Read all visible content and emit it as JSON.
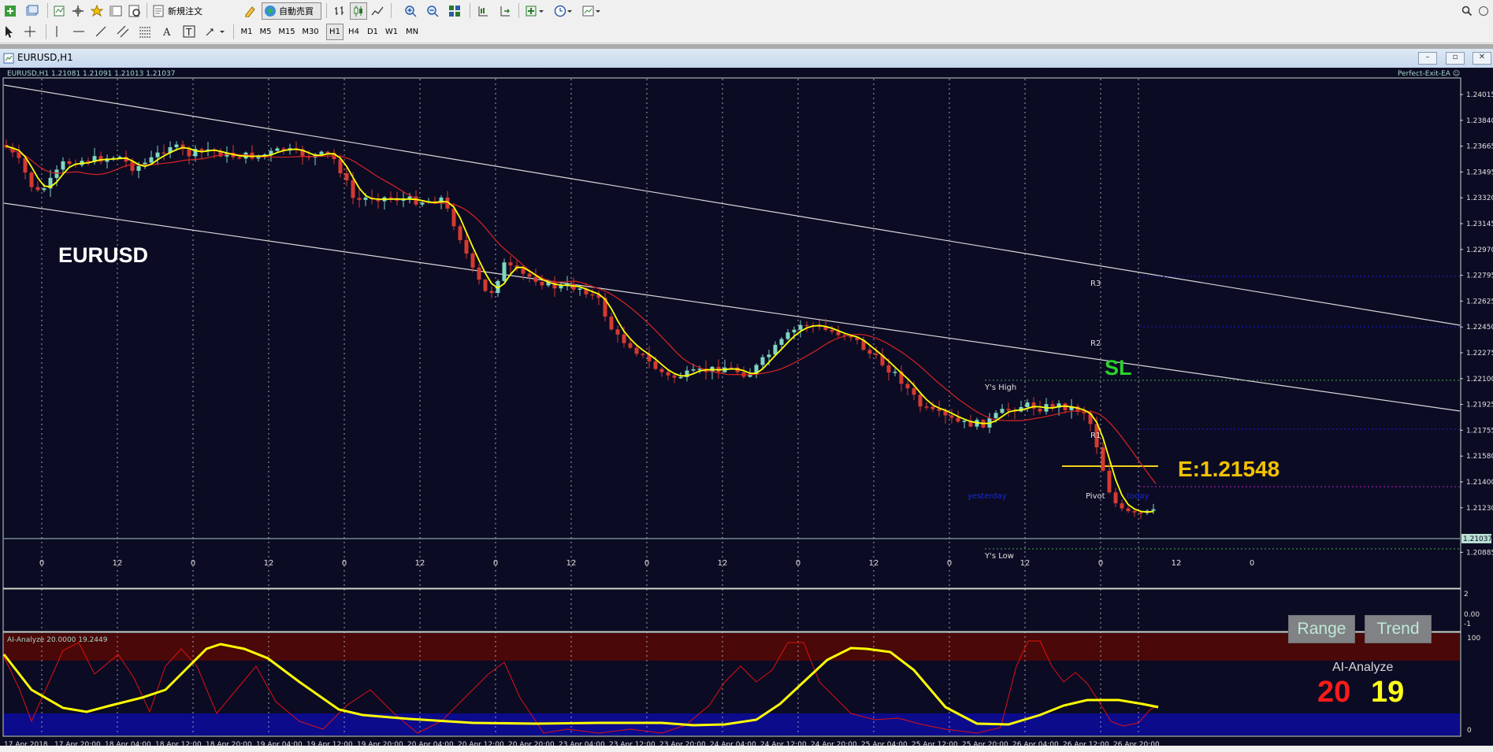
{
  "window": {
    "title": "EURUSD,H1"
  },
  "toolbar": {
    "new_order_label": "新規注文",
    "auto_trade_label": "自動売買",
    "timeframes": [
      "M1",
      "M5",
      "M15",
      "M30",
      "H1",
      "H4",
      "D1",
      "W1",
      "MN"
    ],
    "active_timeframe": "H1"
  },
  "chart": {
    "header": "EURUSD,H1  1.21081 1.21091 1.21013 1.21037",
    "ea_label": "Perfect-Exit-EA ☺",
    "symbol_label": "EURUSD",
    "sl_label": "SL",
    "entry_label": "E:1.21548",
    "level_labels": {
      "r3": "R3",
      "r2": "R2",
      "r1": "R1",
      "pivot": "Pivot",
      "ys_high": "Y's High",
      "ys_low": "Y's Low",
      "yesterday": "yesterday",
      "today": "today"
    },
    "price_ticks": [
      "1.24015",
      "1.23840",
      "1.23665",
      "1.23495",
      "1.23320",
      "1.23145",
      "1.22970",
      "1.22795",
      "1.22625",
      "1.22450",
      "1.22275",
      "1.22100",
      "1.21925",
      "1.21755",
      "1.21580",
      "1.21400",
      "1.21230",
      "1.21037",
      "1.20885"
    ],
    "current_price": "1.21037",
    "hour_ticks": [
      "0",
      "12",
      "0",
      "12",
      "0",
      "12",
      "0",
      "12",
      "0",
      "12",
      "0",
      "12",
      "0",
      "12",
      "0",
      "12",
      "0"
    ],
    "colors": {
      "background": "#0b0b24",
      "bull": "#7fd6c0",
      "bear": "#d43a2f",
      "ma_fast": "#ffff00",
      "ma_slow": "#cc2222",
      "grid": "#c9c9c9"
    }
  },
  "buttons": {
    "range_label": "Range",
    "trend_label": "Trend"
  },
  "indicator": {
    "header": "AI-Analyze 20.0000 19.2449",
    "title": "AI-Analyze",
    "value_red": "20",
    "value_yellow": "19",
    "scale_top": [
      "2",
      "0.00",
      "-1"
    ],
    "scale_bottom": [
      "100",
      "0"
    ],
    "colors": {
      "upper_zone": "#4a0808",
      "lower_zone": "#0b0b8c",
      "red_line": "#e01010",
      "yellow_line": "#ffff00"
    }
  },
  "time_axis": [
    "17 Apr 2018",
    "17 Apr 20:00",
    "18 Apr 04:00",
    "18 Apr 12:00",
    "18 Apr 20:00",
    "19 Apr 04:00",
    "19 Apr 12:00",
    "19 Apr 20:00",
    "20 Apr 04:00",
    "20 Apr 12:00",
    "20 Apr 20:00",
    "23 Apr 04:00",
    "23 Apr 12:00",
    "23 Apr 20:00",
    "24 Apr 04:00",
    "24 Apr 12:00",
    "24 Apr 20:00",
    "25 Apr 04:00",
    "25 Apr 12:00",
    "25 Apr 20:00",
    "26 Apr 04:00",
    "26 Apr 12:00",
    "26 Apr 20:00"
  ]
}
